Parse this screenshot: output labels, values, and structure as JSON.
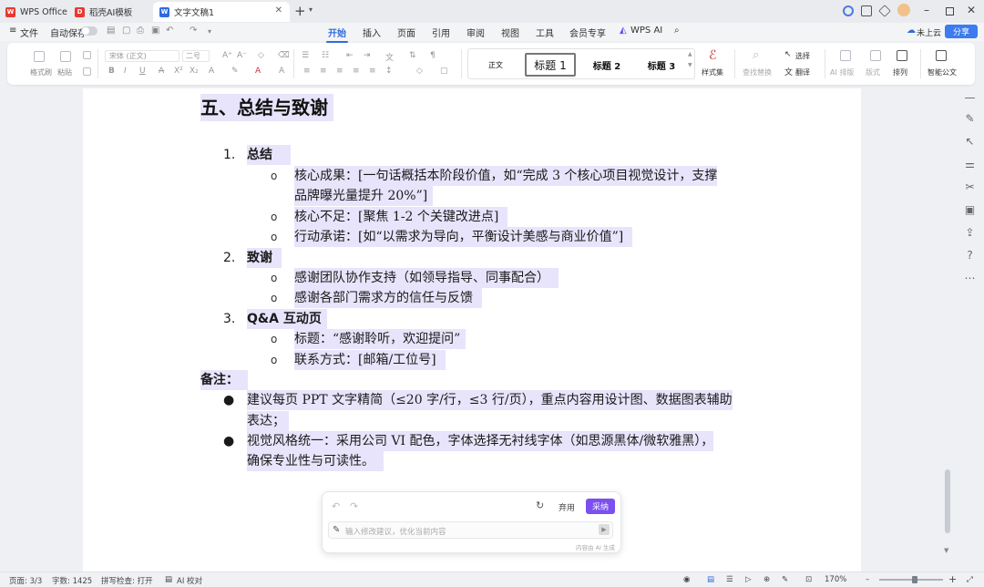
{
  "tabs": [
    {
      "label": "WPS Office",
      "icon": "wps-logo-icon"
    },
    {
      "label": "稻壳AI模板",
      "icon": "docer-logo-icon"
    },
    {
      "label": "文字文稿1",
      "icon": "writer-logo-icon"
    }
  ],
  "menu": {
    "file": "文件",
    "autosave": "自动保存",
    "tabs": [
      "开始",
      "插入",
      "页面",
      "引用",
      "审阅",
      "视图",
      "工具",
      "会员专享",
      "WPS AI"
    ],
    "active_tab": "开始",
    "cloud": "未上云",
    "share": "分享"
  },
  "ribbon": {
    "format_painter": "格式刷",
    "paste": "粘贴",
    "font_name": "宋体 (正文)",
    "font_size": "二号",
    "styles": [
      "正文",
      "标题 1",
      "标题 2",
      "标题 3"
    ],
    "style_set": "样式集",
    "find_replace": "查找替换",
    "select": "选择",
    "translate": "翻译",
    "ai_layout": "AI 排版",
    "layout": "版式",
    "arrange": "排列",
    "smart_doc": "智能公文"
  },
  "document": {
    "heading": "五、总结与致谢",
    "sections": [
      {
        "num": "1.",
        "title": "总结",
        "items": [
          [
            "核心成果：[一句话概括本阶段价值，如“完成 3 个核心项目视觉设计，支撑",
            "品牌曝光量提升 20%”]"
          ],
          [
            "核心不足：[聚焦 1-2 个关键改进点]"
          ],
          [
            "行动承诺：[如“以需求为导向，平衡设计美感与商业价值”]"
          ]
        ]
      },
      {
        "num": "2.",
        "title": "致谢",
        "items": [
          [
            "感谢团队协作支持（如领导指导、同事配合）"
          ],
          [
            "感谢各部门需求方的信任与反馈"
          ]
        ]
      },
      {
        "num": "3.",
        "title": "Q&A 互动页",
        "items": [
          [
            "标题：“感谢聆听，欢迎提问”"
          ],
          [
            "联系方式：[邮箱/工位号]"
          ]
        ]
      }
    ],
    "notes_title": "备注：",
    "notes": [
      [
        "建议每页 PPT 文字精简（≤20 字/行，≤3 行/页），重点内容用设计图、数据图表辅助",
        "表达；"
      ],
      [
        "视觉风格统一：采用公司 VI 配色，字体选择无衬线字体（如思源黑体/微软雅黑），",
        "确保专业性与可读性。"
      ]
    ]
  },
  "ai_panel": {
    "discard": "弃用",
    "accept": "采纳",
    "input_placeholder": "输入修改建议，优化当前内容",
    "footer": "内容由 AI 生成"
  },
  "status": {
    "page": "页面: 3/3",
    "words": "字数: 1425",
    "spellcheck": "拼写检查: 打开",
    "ai_proof": "AI 校对",
    "zoom": "170%"
  },
  "colors": {
    "accent": "#2f6bde",
    "highlight": "#e8e4fb",
    "ai_purple": "#7b4ff0"
  }
}
